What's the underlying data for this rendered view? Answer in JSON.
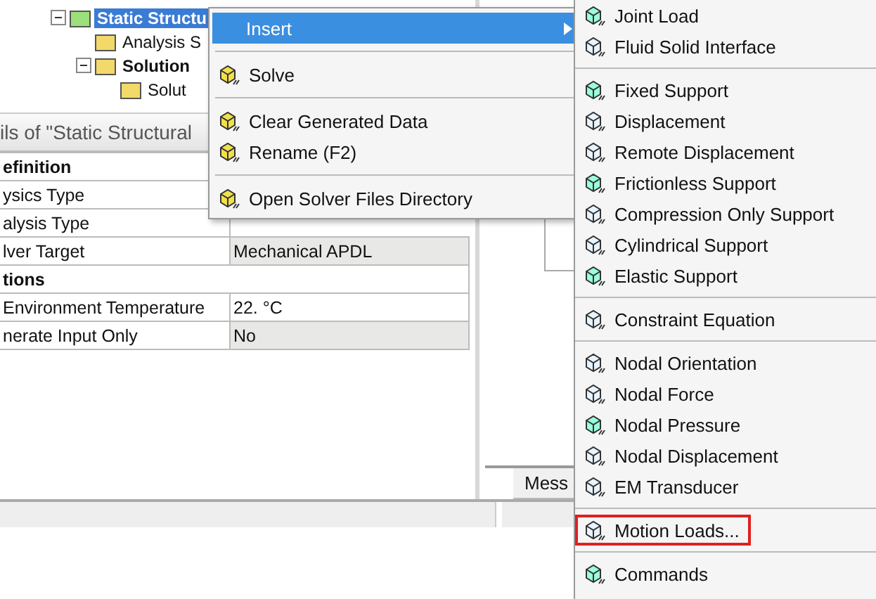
{
  "tree": [
    {
      "label": "Static Structu",
      "selected": true,
      "expanded": true,
      "children": [
        {
          "label": "Analysis S",
          "selected": false
        },
        {
          "label": "Solution",
          "selected": false,
          "expanded": true,
          "bold": true,
          "children": [
            {
              "label": "Solut",
              "selected": false
            }
          ]
        }
      ]
    }
  ],
  "details": {
    "title": "ils of \"Static Structural",
    "rows": [
      {
        "kind": "section",
        "label": "efinition"
      },
      {
        "kind": "prop",
        "label": "ysics Type"
      },
      {
        "kind": "prop",
        "label": "alysis Type"
      },
      {
        "kind": "prop",
        "label": "lver Target",
        "value": "Mechanical APDL",
        "shaded": true
      },
      {
        "kind": "section",
        "label": "tions"
      },
      {
        "kind": "prop",
        "label": "Environment Temperature",
        "value": "22. °C",
        "shaded": false
      },
      {
        "kind": "prop",
        "label": "nerate Input Only",
        "value": "No",
        "shaded": true
      }
    ]
  },
  "messages_tab": "Mess",
  "context_menu": [
    {
      "kind": "item",
      "label": "Insert",
      "selected": true,
      "submenu": true
    },
    {
      "kind": "separator"
    },
    {
      "kind": "item",
      "label": "Solve",
      "selected": false
    },
    {
      "kind": "separator"
    },
    {
      "kind": "item",
      "label": "Clear Generated Data",
      "selected": false
    },
    {
      "kind": "item",
      "label": "Rename (F2)",
      "selected": false
    },
    {
      "kind": "separator"
    },
    {
      "kind": "item",
      "label": "Open Solver Files Directory",
      "selected": false
    }
  ],
  "submenu": [
    {
      "kind": "item",
      "label": "Joint Load",
      "highlighted": false
    },
    {
      "kind": "item",
      "label": "Fluid Solid Interface",
      "highlighted": false
    },
    {
      "kind": "separator"
    },
    {
      "kind": "item",
      "label": "Fixed Support",
      "highlighted": false
    },
    {
      "kind": "item",
      "label": "Displacement",
      "highlighted": false
    },
    {
      "kind": "item",
      "label": "Remote Displacement",
      "highlighted": false
    },
    {
      "kind": "item",
      "label": "Frictionless Support",
      "highlighted": false
    },
    {
      "kind": "item",
      "label": "Compression Only Support",
      "highlighted": false
    },
    {
      "kind": "item",
      "label": "Cylindrical Support",
      "highlighted": false
    },
    {
      "kind": "item",
      "label": "Elastic Support",
      "highlighted": false
    },
    {
      "kind": "separator"
    },
    {
      "kind": "item",
      "label": "Constraint Equation",
      "highlighted": false
    },
    {
      "kind": "separator"
    },
    {
      "kind": "item",
      "label": "Nodal Orientation",
      "highlighted": false
    },
    {
      "kind": "item",
      "label": "Nodal Force",
      "highlighted": false
    },
    {
      "kind": "item",
      "label": "Nodal Pressure",
      "highlighted": false
    },
    {
      "kind": "item",
      "label": "Nodal Displacement",
      "highlighted": false
    },
    {
      "kind": "item",
      "label": "EM Transducer",
      "highlighted": false
    },
    {
      "kind": "separator"
    },
    {
      "kind": "item",
      "label": "Motion Loads...",
      "highlighted": true
    },
    {
      "kind": "separator"
    },
    {
      "kind": "item",
      "label": "Commands",
      "highlighted": false
    }
  ]
}
